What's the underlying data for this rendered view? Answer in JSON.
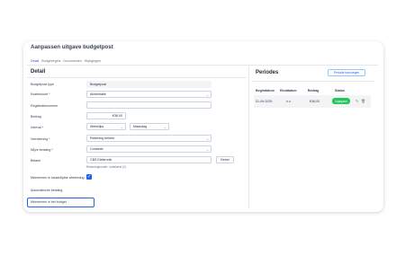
{
  "page": {
    "title": "Aanpassen uitgave budgetpost",
    "tabs": [
      "Detail",
      "Budgetregels",
      "Documenten",
      "Wijzigingen"
    ]
  },
  "detail": {
    "title": "Detail",
    "fields": {
      "budgetpost_type": {
        "label": "Budgetpost type",
        "value": "Budgetpost"
      },
      "kostensoort": {
        "label": "Kostensoort *",
        "value": "Alimentatie"
      },
      "registratienummer": {
        "label": "Registratienummer",
        "value": ""
      },
      "bedrag": {
        "label": "Bedrag",
        "value": "€38,00"
      },
      "interval": {
        "label": "Interval *",
        "value1": "Wekelijks",
        "value2": "Maandag"
      },
      "verrekening": {
        "label": "Verrekening *",
        "value": "Rekening beheer"
      },
      "wijze_betaling": {
        "label": "Wijze betaling *",
        "value": "Contante"
      },
      "betaler": {
        "label": "Betaler",
        "value": "CBS Elektronik",
        "button": "Kiezen",
        "hint": "Rekeninghouder: onbekend (V)"
      },
      "meenemen_tussentijds": {
        "label": "Meenemen in tussentijdse afrekening"
      },
      "automatische_betaling": {
        "label": "Automatische betaling"
      },
      "meenemen_budget": {
        "label": "Meenemen in het budget"
      }
    }
  },
  "periods": {
    "title": "Periodes",
    "add_button": "Periode toevoegen",
    "columns": [
      "Begindatum",
      "Einddatum",
      "Bedrag",
      "Status"
    ],
    "rows": [
      {
        "begindatum": "01-09-2025",
        "einddatum": "n.v.",
        "bedrag": "€38,00",
        "status": "Ingegaan"
      }
    ]
  }
}
